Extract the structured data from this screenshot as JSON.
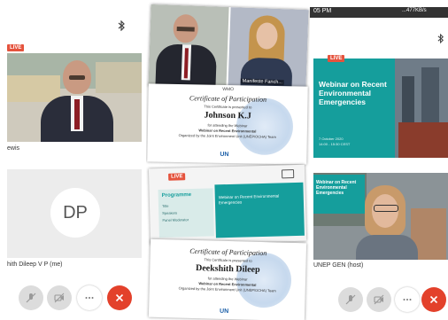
{
  "left_screen": {
    "live_badge": "LIVE",
    "speaker_name": "ewis",
    "avatar_initials": "DP",
    "self_name": "hith Dileep V P (me)",
    "bluetooth_icon": "bluetooth-icon"
  },
  "middle": {
    "top_shot": {
      "participant_name": "Manifeste Fanch..."
    },
    "cert1": {
      "header": "WMO",
      "title": "Certificate of Participation",
      "subtitle": "This Certificate is presented to",
      "name": "Johnson K.J",
      "line1": "for attending the Webinar",
      "line2": "Webinar on Recent Environmental",
      "line3": "Organized by the Joint Environment Unit (UNEP/OCHA) Team",
      "un_text": "UN"
    },
    "program": {
      "live_badge": "LIVE",
      "title": "Programme",
      "left_lines": [
        "Title",
        "Speakers",
        "Panel Moderator"
      ],
      "banner_lines": [
        "Webinar on Recent Environmental Emergencies"
      ]
    },
    "cert2": {
      "title": "Certificate of Participation",
      "subtitle": "This Certificate is presented to",
      "name": "Deekshith Dileep",
      "line1": "for attending the Webinar",
      "line2": "Webinar on Recent Environmental",
      "line3": "Organized by the Joint Environment Unit (UNEP/OCHA) Team",
      "un_text": "UN"
    }
  },
  "right_screen": {
    "status_time": "05 PM",
    "status_right": "...477KB/s",
    "live_badge": "LIVE",
    "webinar_title": "Webinar on Recent Environmental Emergencies",
    "webinar_date": "7 October 2020",
    "webinar_time": "14:00 - 15:30 CEST",
    "inset_title": "Webinar on Recent Environmental Emergencies",
    "host_name": "UNEP GEN (host)"
  },
  "colors": {
    "live": "#e5533d",
    "teal": "#159e9c",
    "end_call": "#e3412b"
  }
}
